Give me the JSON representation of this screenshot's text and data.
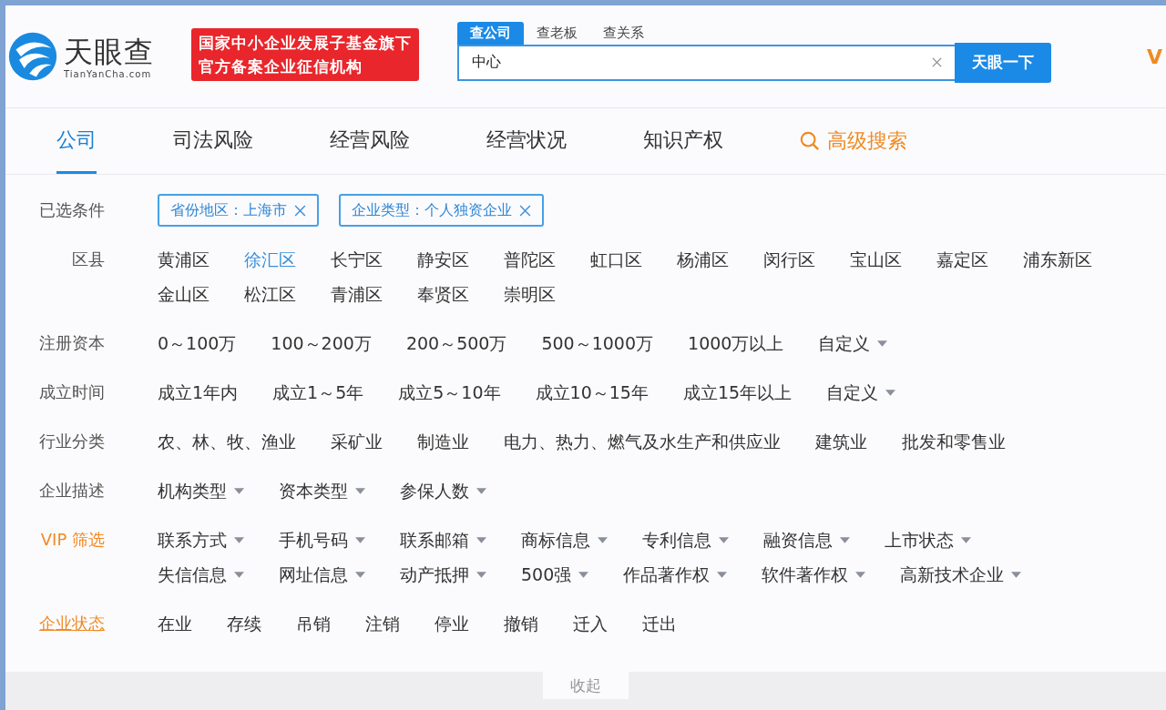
{
  "header": {
    "logo": {
      "name": "天眼查",
      "domain": "TianYanCha.com"
    },
    "banner": [
      "国家中小企业发展子基金旗下",
      "官方备案企业征信机构"
    ],
    "search": {
      "tabs": [
        {
          "label": "查公司",
          "selected": true
        },
        {
          "label": "查老板",
          "selected": false
        },
        {
          "label": "查关系",
          "selected": false
        }
      ],
      "value": "中心",
      "button": "天眼一下"
    },
    "vip": "V"
  },
  "nav": {
    "tabs": [
      {
        "label": "公司",
        "selected": true
      },
      {
        "label": "司法风险",
        "selected": false
      },
      {
        "label": "经营风险",
        "selected": false
      },
      {
        "label": "经营状况",
        "selected": false
      },
      {
        "label": "知识产权",
        "selected": false
      }
    ],
    "advanced": "高级搜索"
  },
  "filters": [
    {
      "label": "已选条件",
      "kind": "chips",
      "accent": false,
      "underlined": false,
      "chips": [
        "省份地区：上海市",
        "企业类型：个人独资企业"
      ]
    },
    {
      "label": "区县",
      "kind": "options",
      "accent": false,
      "underlined": false,
      "lines": [
        [
          {
            "label": "黄浦区",
            "selected": false,
            "dropdown": false
          },
          {
            "label": "徐汇区",
            "selected": true,
            "dropdown": false
          },
          {
            "label": "长宁区",
            "selected": false,
            "dropdown": false
          },
          {
            "label": "静安区",
            "selected": false,
            "dropdown": false
          },
          {
            "label": "普陀区",
            "selected": false,
            "dropdown": false
          },
          {
            "label": "虹口区",
            "selected": false,
            "dropdown": false
          },
          {
            "label": "杨浦区",
            "selected": false,
            "dropdown": false
          },
          {
            "label": "闵行区",
            "selected": false,
            "dropdown": false
          },
          {
            "label": "宝山区",
            "selected": false,
            "dropdown": false
          },
          {
            "label": "嘉定区",
            "selected": false,
            "dropdown": false
          },
          {
            "label": "浦东新区",
            "selected": false,
            "dropdown": false
          }
        ],
        [
          {
            "label": "金山区",
            "selected": false,
            "dropdown": false
          },
          {
            "label": "松江区",
            "selected": false,
            "dropdown": false
          },
          {
            "label": "青浦区",
            "selected": false,
            "dropdown": false
          },
          {
            "label": "奉贤区",
            "selected": false,
            "dropdown": false
          },
          {
            "label": "崇明区",
            "selected": false,
            "dropdown": false
          }
        ]
      ]
    },
    {
      "label": "注册资本",
      "kind": "options",
      "accent": false,
      "underlined": false,
      "lines": [
        [
          {
            "label": "0～100万",
            "selected": false,
            "dropdown": false
          },
          {
            "label": "100～200万",
            "selected": false,
            "dropdown": false
          },
          {
            "label": "200～500万",
            "selected": false,
            "dropdown": false
          },
          {
            "label": "500～1000万",
            "selected": false,
            "dropdown": false
          },
          {
            "label": "1000万以上",
            "selected": false,
            "dropdown": false
          },
          {
            "label": "自定义",
            "selected": false,
            "dropdown": true
          }
        ]
      ]
    },
    {
      "label": "成立时间",
      "kind": "options",
      "accent": false,
      "underlined": false,
      "lines": [
        [
          {
            "label": "成立1年内",
            "selected": false,
            "dropdown": false
          },
          {
            "label": "成立1～5年",
            "selected": false,
            "dropdown": false
          },
          {
            "label": "成立5～10年",
            "selected": false,
            "dropdown": false
          },
          {
            "label": "成立10～15年",
            "selected": false,
            "dropdown": false
          },
          {
            "label": "成立15年以上",
            "selected": false,
            "dropdown": false
          },
          {
            "label": "自定义",
            "selected": false,
            "dropdown": true
          }
        ]
      ]
    },
    {
      "label": "行业分类",
      "kind": "options",
      "accent": false,
      "underlined": false,
      "lines": [
        [
          {
            "label": "农、林、牧、渔业",
            "selected": false,
            "dropdown": false
          },
          {
            "label": "采矿业",
            "selected": false,
            "dropdown": false
          },
          {
            "label": "制造业",
            "selected": false,
            "dropdown": false
          },
          {
            "label": "电力、热力、燃气及水生产和供应业",
            "selected": false,
            "dropdown": false
          },
          {
            "label": "建筑业",
            "selected": false,
            "dropdown": false
          },
          {
            "label": "批发和零售业",
            "selected": false,
            "dropdown": false
          }
        ]
      ]
    },
    {
      "label": "企业描述",
      "kind": "options",
      "accent": false,
      "underlined": false,
      "lines": [
        [
          {
            "label": "机构类型",
            "selected": false,
            "dropdown": true
          },
          {
            "label": "资本类型",
            "selected": false,
            "dropdown": true
          },
          {
            "label": "参保人数",
            "selected": false,
            "dropdown": true
          }
        ]
      ]
    },
    {
      "label": "VIP 筛选",
      "kind": "options",
      "accent": true,
      "underlined": false,
      "lines": [
        [
          {
            "label": "联系方式",
            "selected": false,
            "dropdown": true
          },
          {
            "label": "手机号码",
            "selected": false,
            "dropdown": true
          },
          {
            "label": "联系邮箱",
            "selected": false,
            "dropdown": true
          },
          {
            "label": "商标信息",
            "selected": false,
            "dropdown": true
          },
          {
            "label": "专利信息",
            "selected": false,
            "dropdown": true
          },
          {
            "label": "融资信息",
            "selected": false,
            "dropdown": true
          },
          {
            "label": "上市状态",
            "selected": false,
            "dropdown": true
          }
        ],
        [
          {
            "label": "失信信息",
            "selected": false,
            "dropdown": true
          },
          {
            "label": "网址信息",
            "selected": false,
            "dropdown": true
          },
          {
            "label": "动产抵押",
            "selected": false,
            "dropdown": true
          },
          {
            "label": "500强",
            "selected": false,
            "dropdown": true
          },
          {
            "label": "作品著作权",
            "selected": false,
            "dropdown": true
          },
          {
            "label": "软件著作权",
            "selected": false,
            "dropdown": true
          },
          {
            "label": "高新技术企业",
            "selected": false,
            "dropdown": true
          }
        ]
      ]
    },
    {
      "label": "企业状态",
      "kind": "options",
      "accent": true,
      "underlined": true,
      "lines": [
        [
          {
            "label": "在业",
            "selected": false,
            "dropdown": false
          },
          {
            "label": "存续",
            "selected": false,
            "dropdown": false
          },
          {
            "label": "吊销",
            "selected": false,
            "dropdown": false
          },
          {
            "label": "注销",
            "selected": false,
            "dropdown": false
          },
          {
            "label": "停业",
            "selected": false,
            "dropdown": false
          },
          {
            "label": "撤销",
            "selected": false,
            "dropdown": false
          },
          {
            "label": "迁入",
            "selected": false,
            "dropdown": false
          },
          {
            "label": "迁出",
            "selected": false,
            "dropdown": false
          }
        ]
      ]
    }
  ],
  "collapse": "收起"
}
